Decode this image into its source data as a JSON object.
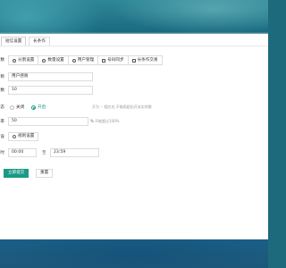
{
  "tabs": [
    {
      "label": "短信设置",
      "active": true
    },
    {
      "label": "长条作",
      "active": false
    }
  ],
  "rows": {
    "type": {
      "label": "数",
      "items": [
        {
          "label": "分割设置",
          "icon": "circle-icon"
        },
        {
          "label": "数量设置",
          "icon": "circle-icon"
        },
        {
          "label": "用户管理",
          "icon": "user-icon"
        },
        {
          "label": "号码同步",
          "icon": "square-icon"
        },
        {
          "label": "长条作交易",
          "icon": "square-icon"
        }
      ]
    },
    "name": {
      "label": "称",
      "value": "用户感谢"
    },
    "count": {
      "label": "数",
      "value": "10"
    },
    "status": {
      "label": "态",
      "options": [
        "关闭",
        "开启"
      ],
      "selected": "开启",
      "hint": "开为 -- 相应名,不能再超出开关实时数"
    },
    "percent": {
      "label": "率",
      "value": "50",
      "unit": "%",
      "hint": "不能超过100%"
    },
    "set": {
      "label": "设",
      "button": "规则设置"
    },
    "time": {
      "label": "时",
      "start": "00:00",
      "sep": "至",
      "end": "23:59"
    }
  },
  "actions": {
    "submit": "立即提交",
    "reset": "重置"
  },
  "colors": {
    "accent": "#1a9a86",
    "header_bg": "#2f8796",
    "footer_bg": "#1a5e86"
  }
}
